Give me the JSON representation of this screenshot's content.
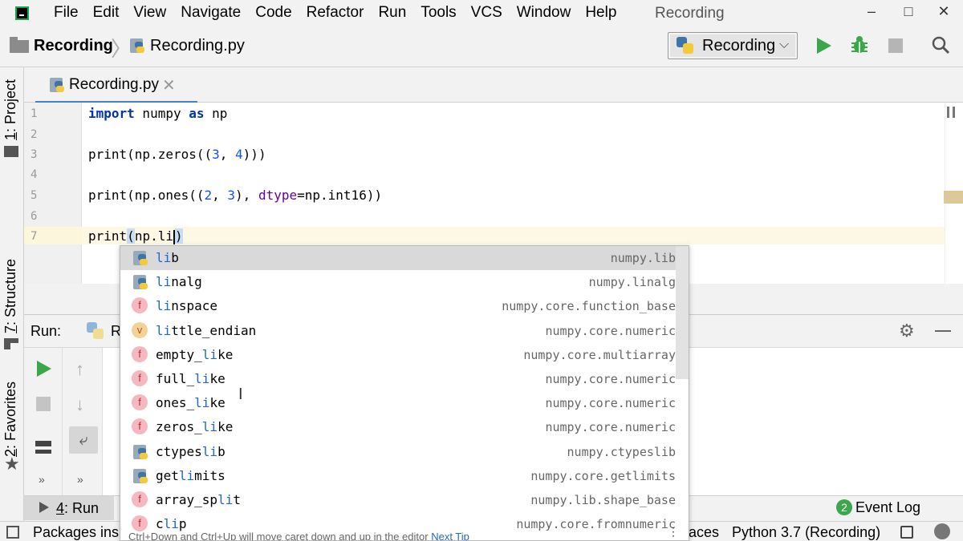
{
  "menubar": {
    "items": [
      "File",
      "Edit",
      "View",
      "Navigate",
      "Code",
      "Refactor",
      "Run",
      "Tools",
      "VCS",
      "Window",
      "Help"
    ],
    "window_title": "Recording",
    "controls": {
      "minimize": "–",
      "maximize": "□",
      "close": "✕"
    }
  },
  "navbar": {
    "project": "Recording",
    "separator": "〉",
    "file": "Recording.py",
    "run_config": "Recording",
    "run_config_chevron": "⌵"
  },
  "left_strip": {
    "project_num": "1",
    "project": ": Project",
    "structure_num": "7",
    "structure": ": Structure",
    "favorites_num": "2",
    "favorites": ": Favorites"
  },
  "editor": {
    "tab_label": "Recording.py",
    "tab_close": "✕",
    "line_numbers": [
      "1",
      "2",
      "3",
      "4",
      "5",
      "6",
      "7"
    ],
    "lines": {
      "l1_kw1": "import",
      "l1_mid": " numpy ",
      "l1_kw2": "as",
      "l1_end": " np",
      "l3_a": "print(np.zeros((",
      "l3_n1": "3",
      "l3_b": ", ",
      "l3_n2": "4",
      "l3_c": ")))",
      "l5_a": "print(np.ones((",
      "l5_n1": "2",
      "l5_b": ", ",
      "l5_n2": "3",
      "l5_c": "), ",
      "l5_kw": "dtype",
      "l5_d": "=np.int16))",
      "l7_a": "print",
      "l7_p": "(",
      "l7_b": "np.li",
      "l7_close": ")"
    }
  },
  "completion": {
    "items": [
      {
        "icon": "module",
        "pre": "li",
        "post": "b",
        "src": "numpy.lib",
        "selected": true
      },
      {
        "icon": "module",
        "pre": "li",
        "post": "nalg",
        "src": "numpy.linalg"
      },
      {
        "icon": "f",
        "pre": "li",
        "post": "nspace",
        "src": "numpy.core.function_base"
      },
      {
        "icon": "v",
        "pre": "li",
        "post": "ttle_endian",
        "src": "numpy.core.numeric"
      },
      {
        "icon": "f",
        "pre": "empty_",
        "mid": "li",
        "post": "ke",
        "src": "numpy.core.multiarray"
      },
      {
        "icon": "f",
        "pre": "full_",
        "mid": "li",
        "post": "ke",
        "src": "numpy.core.numeric"
      },
      {
        "icon": "f",
        "pre": "ones_",
        "mid": "li",
        "post": "ke",
        "src": "numpy.core.numeric"
      },
      {
        "icon": "f",
        "pre": "zeros_",
        "mid": "li",
        "post": "ke",
        "src": "numpy.core.numeric"
      },
      {
        "icon": "module",
        "pre": "ctypes",
        "mid": "li",
        "post": "b",
        "src": "numpy.ctypeslib"
      },
      {
        "icon": "module",
        "pre": "get",
        "mid": "li",
        "post": "mits",
        "src": "numpy.core.getlimits"
      },
      {
        "icon": "f",
        "pre": "array_sp",
        "mid": "li",
        "post": "t",
        "src": "numpy.lib.shape_base"
      },
      {
        "icon": "f",
        "pre": "c",
        "mid": "li",
        "post": "p",
        "src": "numpy.core.fromnumeric"
      }
    ],
    "tip": "Ctrl+Down and Ctrl+Up will move caret down and up in the editor",
    "tip_link": "Next Tip",
    "more": "⋮"
  },
  "run_panel": {
    "title": "Run:",
    "tab_label": "R",
    "settings": "⚙",
    "up": "↑",
    "down": "↓",
    "wrap": "⤶",
    "more": "»"
  },
  "bottom": {
    "run_tool_num": "4",
    "run_tool": ": Run",
    "event_count": "2",
    "event_log": "Event Log"
  },
  "statusbar": {
    "packages": "Packages ins",
    "aces": "aces",
    "interpreter": "Python 3.7 (Recording)"
  },
  "colors": {
    "accent": "#4083c9",
    "run_green": "#3ca64b",
    "keyword": "#0033b3",
    "number": "#1750eb",
    "kwarg": "#660099",
    "match": "#2267c9"
  }
}
